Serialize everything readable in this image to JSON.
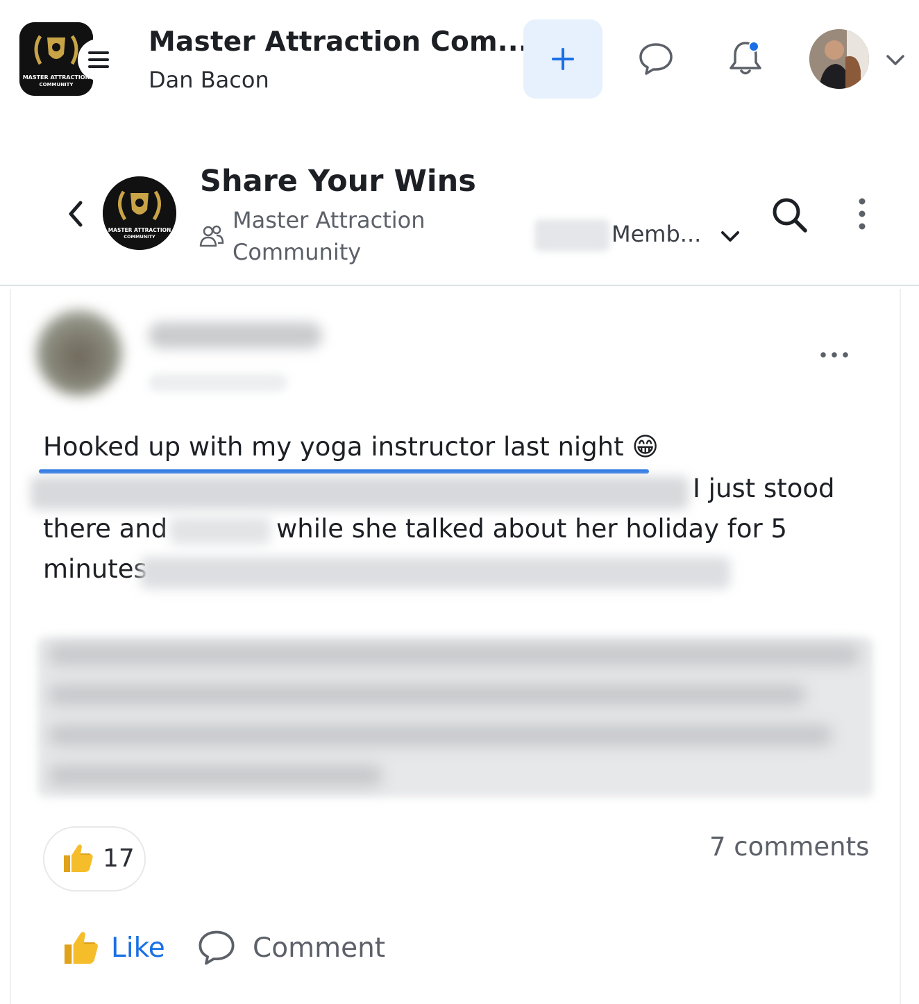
{
  "app_bar": {
    "title": "Master Attraction Com...",
    "subtitle": "Dan Bacon",
    "logo_text": "MASTER ATTRACTION COMMUNITY",
    "accent": "#1a6fe6",
    "plus_bg": "#e6f1fd"
  },
  "group": {
    "title": "Share Your Wins",
    "community": "Master Attraction Community",
    "membership": "Memb...",
    "logo_text": "MASTER ATTRACTION COMMUNITY"
  },
  "post": {
    "title": "Hooked up with my yoga instructor last night",
    "title_emoji": "😁",
    "line2_visible": "I just stood",
    "line3_a": "there and",
    "line3_b": "while she talked about her holiday for 5",
    "line4": "minutes",
    "reaction_count": "17",
    "comments": "7 comments",
    "like_label": "Like",
    "comment_label": "Comment"
  },
  "icons": {
    "menu": "hamburger-icon",
    "create": "plus-icon",
    "chat": "chat-bubble-icon",
    "notifications": "bell-icon",
    "back": "chevron-left-icon",
    "search": "search-icon",
    "more": "kebab-icon"
  }
}
